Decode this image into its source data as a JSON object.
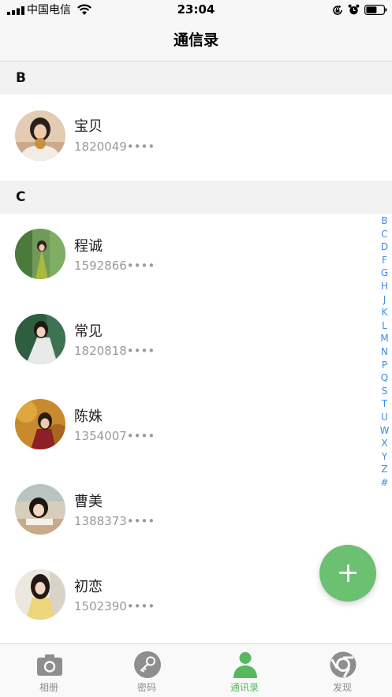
{
  "status_bar": {
    "carrier": "中国电信",
    "time": "23:04",
    "icons": [
      "signal-icon",
      "wifi-icon",
      "rotation-lock-icon",
      "alarm-icon",
      "battery-icon"
    ]
  },
  "nav": {
    "title": "通信录"
  },
  "sections": [
    {
      "letter": "B",
      "contacts": [
        {
          "name": "宝贝",
          "phone": "1820049••••"
        }
      ]
    },
    {
      "letter": "C",
      "contacts": [
        {
          "name": "程诚",
          "phone": "1592866••••"
        },
        {
          "name": "常见",
          "phone": "1820818••••"
        },
        {
          "name": "陈姝",
          "phone": "1354007••••"
        },
        {
          "name": "曹美",
          "phone": "1388373••••"
        },
        {
          "name": "初恋",
          "phone": "1502390••••"
        }
      ]
    }
  ],
  "alphabet_index": [
    "B",
    "C",
    "D",
    "F",
    "G",
    "H",
    "J",
    "K",
    "L",
    "M",
    "N",
    "P",
    "Q",
    "S",
    "T",
    "U",
    "W",
    "X",
    "Y",
    "Z",
    "#"
  ],
  "fab": {
    "icon": "plus-icon"
  },
  "tabs": [
    {
      "label": "相册",
      "icon": "camera-icon",
      "active": false
    },
    {
      "label": "密码",
      "icon": "key-icon",
      "active": false
    },
    {
      "label": "通讯录",
      "icon": "person-icon",
      "active": true
    },
    {
      "label": "发现",
      "icon": "discover-icon",
      "active": false
    }
  ],
  "colors": {
    "accent_green": "#6cc071",
    "index_blue": "#3f8ae6",
    "secondary_text": "#9a9a9a"
  }
}
